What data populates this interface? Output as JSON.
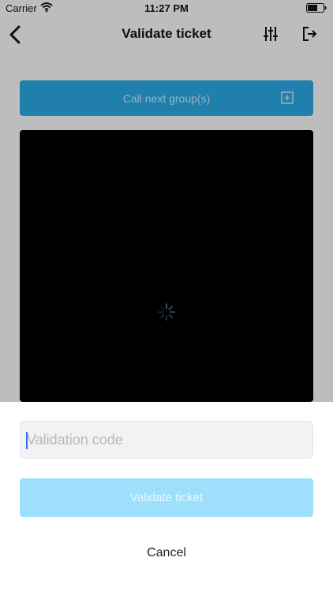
{
  "status_bar": {
    "carrier": "Carrier",
    "time": "11:27 PM"
  },
  "nav": {
    "title": "Validate ticket",
    "icons": [
      "back-chevron-icon",
      "filter-sliders-icon",
      "logout-icon"
    ]
  },
  "call_button": {
    "label": "Call next group(s)",
    "icon": "add-square-icon"
  },
  "camera": {
    "state_icon": "loading-spinner-icon"
  },
  "sheet": {
    "code_input": {
      "placeholder": "Validation code",
      "value": ""
    },
    "validate_label": "Validate ticket",
    "cancel_label": "Cancel"
  },
  "colors": {
    "call_button_bg": "#2aa3de",
    "validate_button_bg": "#9ee0fb",
    "camera_bg": "#000000"
  }
}
